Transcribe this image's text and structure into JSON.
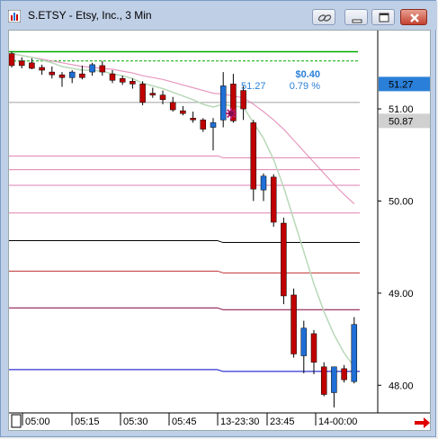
{
  "window": {
    "title": "S.ETSY - Etsy, Inc., 3 Min",
    "buttons": [
      "link-icon",
      "minimize-icon",
      "restore-icon",
      "close-icon"
    ]
  },
  "colors": {
    "up": "#1f6fd6",
    "down": "#c00000",
    "green": "#00aa00",
    "pink": "#e080b0",
    "ema": "#b8d8b8",
    "blue_line": "#0000cc",
    "purple_line": "#800040",
    "red_line": "#c03030",
    "black_line": "#000000",
    "last_price_tag": "#2a7fd8",
    "current_price_tag": "#d0d0d0"
  },
  "price_tags": {
    "last_price": "51.27",
    "current_price": "50.87"
  },
  "info_box": {
    "change": "$0.40",
    "price": "51.27",
    "percent": "0.79 %"
  },
  "nav_arrow": "right-arrow-icon",
  "chart_data": {
    "type": "candlestick",
    "x_labels": [
      "05:00",
      "05:15",
      "05:30",
      "05:45",
      "13-23:30",
      "23:45",
      "14-00:00"
    ],
    "y_ticks": [
      48.0,
      49.0,
      50.0,
      51.0
    ],
    "ylim": [
      47.7,
      51.85
    ],
    "levels": [
      {
        "price": 51.62,
        "color": "green",
        "style": "solid"
      },
      {
        "price": 51.52,
        "color": "green",
        "style": "dashed"
      },
      {
        "price": 51.07,
        "color": "gray",
        "style": "solid"
      },
      {
        "price": 50.47,
        "color": "pink",
        "style": "solid"
      },
      {
        "price": 50.34,
        "color": "pink",
        "style": "solid"
      },
      {
        "price": 50.17,
        "color": "pink",
        "style": "solid"
      },
      {
        "price": 49.87,
        "color": "pink",
        "style": "solid"
      },
      {
        "price": 49.55,
        "color": "black",
        "style": "solid"
      },
      {
        "price": 49.22,
        "color": "red",
        "style": "solid"
      },
      {
        "price": 48.82,
        "color": "purple",
        "style": "solid"
      },
      {
        "price": 48.15,
        "color": "blue",
        "style": "solid"
      }
    ],
    "candles": [
      {
        "o": 51.6,
        "h": 51.62,
        "l": 51.45,
        "c": 51.47
      },
      {
        "o": 51.52,
        "h": 51.56,
        "l": 51.44,
        "c": 51.47
      },
      {
        "o": 51.5,
        "h": 51.55,
        "l": 51.43,
        "c": 51.44
      },
      {
        "o": 51.45,
        "h": 51.48,
        "l": 51.37,
        "c": 51.42
      },
      {
        "o": 51.4,
        "h": 51.46,
        "l": 51.33,
        "c": 51.37
      },
      {
        "o": 51.37,
        "h": 51.4,
        "l": 51.24,
        "c": 51.34
      },
      {
        "o": 51.34,
        "h": 51.42,
        "l": 51.28,
        "c": 51.4
      },
      {
        "o": 51.38,
        "h": 51.47,
        "l": 51.32,
        "c": 51.34
      },
      {
        "o": 51.4,
        "h": 51.5,
        "l": 51.36,
        "c": 51.48
      },
      {
        "o": 51.47,
        "h": 51.52,
        "l": 51.36,
        "c": 51.4
      },
      {
        "o": 51.38,
        "h": 51.42,
        "l": 51.28,
        "c": 51.31
      },
      {
        "o": 51.33,
        "h": 51.36,
        "l": 51.26,
        "c": 51.29
      },
      {
        "o": 51.3,
        "h": 51.33,
        "l": 51.22,
        "c": 51.27
      },
      {
        "o": 51.27,
        "h": 51.3,
        "l": 51.04,
        "c": 51.07
      },
      {
        "o": 51.17,
        "h": 51.23,
        "l": 51.12,
        "c": 51.15
      },
      {
        "o": 51.15,
        "h": 51.2,
        "l": 51.05,
        "c": 51.1
      },
      {
        "o": 51.07,
        "h": 51.13,
        "l": 50.97,
        "c": 50.99
      },
      {
        "o": 50.98,
        "h": 51.03,
        "l": 50.93,
        "c": 50.95
      },
      {
        "o": 50.9,
        "h": 50.97,
        "l": 50.85,
        "c": 50.88
      },
      {
        "o": 50.88,
        "h": 50.9,
        "l": 50.75,
        "c": 50.78
      },
      {
        "o": 50.8,
        "h": 50.9,
        "l": 50.55,
        "c": 50.85
      },
      {
        "o": 50.88,
        "h": 51.4,
        "l": 50.8,
        "c": 51.25
      },
      {
        "o": 51.27,
        "h": 51.38,
        "l": 50.85,
        "c": 50.87
      },
      {
        "o": 51.2,
        "h": 51.25,
        "l": 50.88,
        "c": 51.0
      },
      {
        "o": 50.85,
        "h": 50.88,
        "l": 50.0,
        "c": 50.13
      },
      {
        "o": 50.12,
        "h": 50.3,
        "l": 50.0,
        "c": 50.27
      },
      {
        "o": 50.26,
        "h": 50.29,
        "l": 49.72,
        "c": 49.77
      },
      {
        "o": 49.76,
        "h": 49.82,
        "l": 48.88,
        "c": 48.97
      },
      {
        "o": 48.98,
        "h": 49.05,
        "l": 48.3,
        "c": 48.34
      },
      {
        "o": 48.32,
        "h": 48.7,
        "l": 48.13,
        "c": 48.62
      },
      {
        "o": 48.56,
        "h": 48.6,
        "l": 48.12,
        "c": 48.25
      },
      {
        "o": 48.2,
        "h": 48.25,
        "l": 47.88,
        "c": 47.9
      },
      {
        "o": 47.92,
        "h": 48.2,
        "l": 47.76,
        "c": 48.2
      },
      {
        "o": 48.18,
        "h": 48.22,
        "l": 48.03,
        "c": 48.06
      },
      {
        "o": 48.04,
        "h": 48.74,
        "l": 48.02,
        "c": 48.66
      }
    ],
    "ema_fast": [
      51.6,
      51.58,
      51.56,
      51.53,
      51.5,
      51.46,
      51.44,
      51.42,
      51.42,
      51.41,
      51.38,
      51.36,
      51.33,
      51.28,
      51.25,
      51.22,
      51.18,
      51.14,
      51.1,
      51.05,
      51.02,
      51.05,
      51.03,
      51.02,
      50.85,
      50.68,
      50.45,
      50.15,
      49.8,
      49.45,
      49.1,
      48.8,
      48.55,
      48.35,
      48.2
    ],
    "ema_slow": [
      51.6,
      51.58,
      51.56,
      51.54,
      51.52,
      51.5,
      51.48,
      51.46,
      51.45,
      51.44,
      51.43,
      51.41,
      51.39,
      51.36,
      51.34,
      51.32,
      51.29,
      51.26,
      51.23,
      51.2,
      51.17,
      51.16,
      51.14,
      51.12,
      51.05,
      50.97,
      50.88,
      50.78,
      50.66,
      50.54,
      50.42,
      50.3,
      50.18,
      50.07,
      49.97
    ]
  }
}
